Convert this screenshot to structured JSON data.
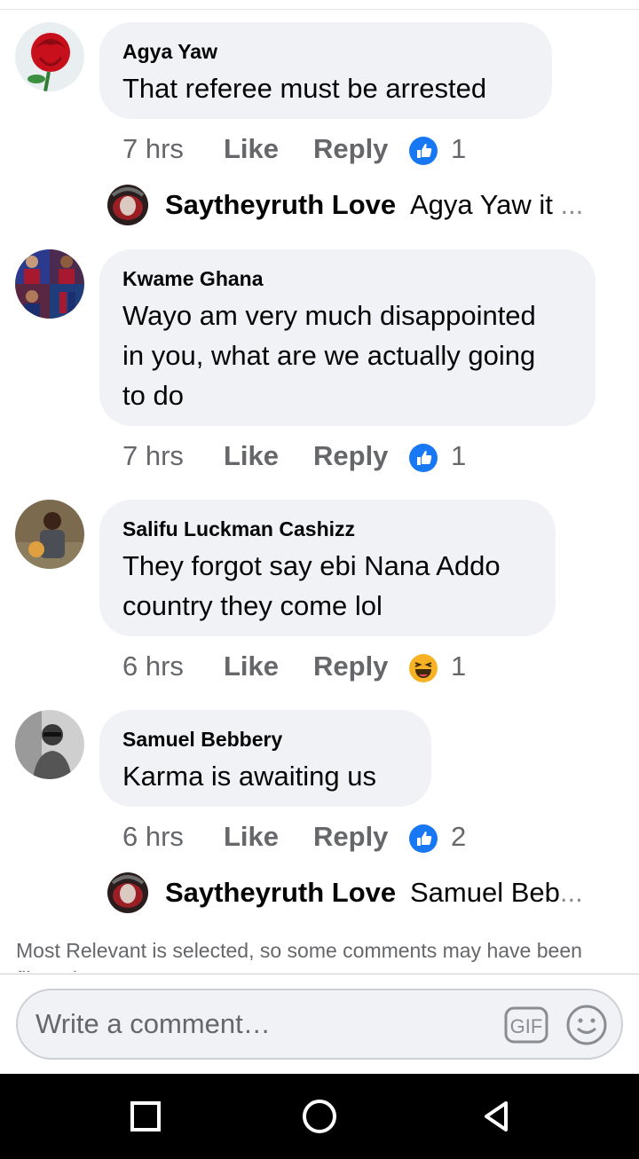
{
  "comments": [
    {
      "author": "Agya Yaw",
      "lines": [
        "That referee must be arrested"
      ],
      "time": "7 hrs",
      "like": "Like",
      "reply": "Reply",
      "reaction": "like-icon",
      "reaction_count": "1"
    },
    {
      "author": "Kwame Ghana",
      "lines": [
        "Wayo am very much disappointed",
        "in you, what are we actually going",
        "to do"
      ],
      "time": "7 hrs",
      "like": "Like",
      "reply": "Reply",
      "reaction": "like-icon",
      "reaction_count": "1"
    },
    {
      "author": "Salifu Luckman Cashizz",
      "lines": [
        "They forgot say ebi Nana Addo",
        "country they come lol"
      ],
      "time": "6 hrs",
      "like": "Like",
      "reply": "Reply",
      "reaction": "haha-icon",
      "reaction_count": "1"
    },
    {
      "author": "Samuel Bebbery",
      "lines": [
        "Karma is awaiting us"
      ],
      "time": "6 hrs",
      "like": "Like",
      "reply": "Reply",
      "reaction": "like-icon",
      "reaction_count": "2"
    }
  ],
  "replies": [
    {
      "author": "Saytheyruth Love",
      "preview": "Agya Yaw it",
      "ellipsis": "..."
    },
    {
      "author": "Saytheyruth Love",
      "preview": "Samuel Beb",
      "ellipsis": "..."
    }
  ],
  "notice": "Most Relevant is selected, so some comments may have been filtered out.",
  "composer": {
    "placeholder": "Write a comment…",
    "gif_label": "GIF"
  },
  "colors": {
    "bubble": "#f0f2f5",
    "like_blue": "#1877f2",
    "meta_gray": "#65676b"
  }
}
